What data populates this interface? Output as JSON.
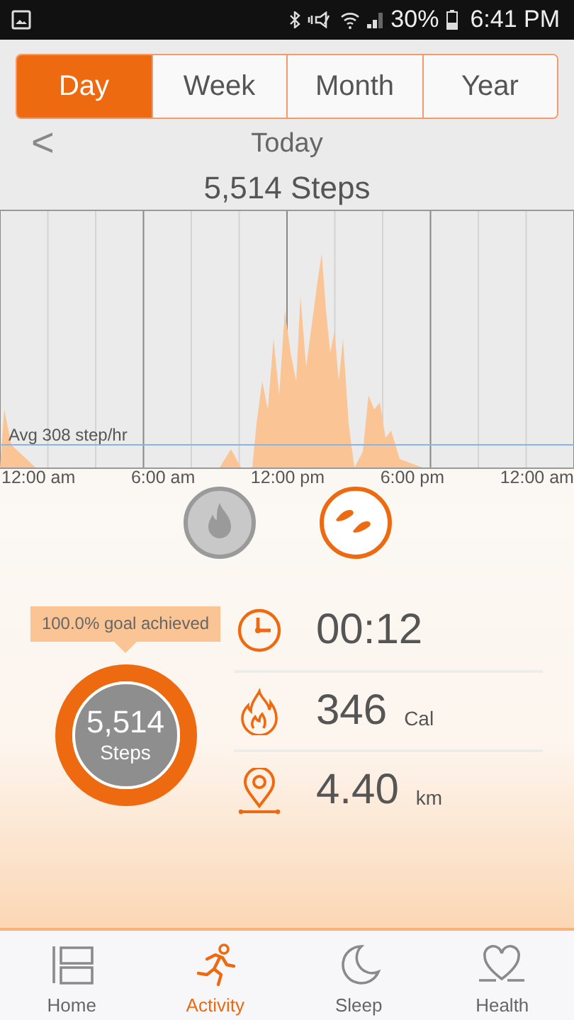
{
  "status_bar": {
    "battery": "30%",
    "time": "6:41 PM"
  },
  "tabs": [
    {
      "label": "Day",
      "selected": true
    },
    {
      "label": "Week",
      "selected": false
    },
    {
      "label": "Month",
      "selected": false
    },
    {
      "label": "Year",
      "selected": false
    }
  ],
  "period": {
    "back": "<",
    "label": "Today"
  },
  "total": "5,514 Steps",
  "chart": {
    "average_label": "Avg 308 step/hr",
    "x_labels": [
      "12:00 am",
      "6:00 am",
      "12:00 pm",
      "6:00 pm",
      "12:00 am"
    ]
  },
  "modes": [
    {
      "kind": "calories",
      "selected": false
    },
    {
      "kind": "steps",
      "selected": true
    }
  ],
  "goal": {
    "label": "100.0% goal achieved",
    "level": 1,
    "value": "5,514",
    "unit": "Steps"
  },
  "stats": [
    {
      "kind": "time",
      "value": "00:12"
    },
    {
      "kind": "calories",
      "value": "346",
      "unit": "Cal"
    },
    {
      "kind": "distance",
      "value": "4.40",
      "unit": "km"
    }
  ],
  "nav": [
    {
      "kind": "home",
      "label": "Home",
      "selected": false
    },
    {
      "kind": "activity",
      "label": "Activity",
      "selected": true
    },
    {
      "kind": "sleep",
      "label": "Sleep",
      "selected": false
    },
    {
      "kind": "health",
      "label": "Health",
      "selected": false
    }
  ]
}
